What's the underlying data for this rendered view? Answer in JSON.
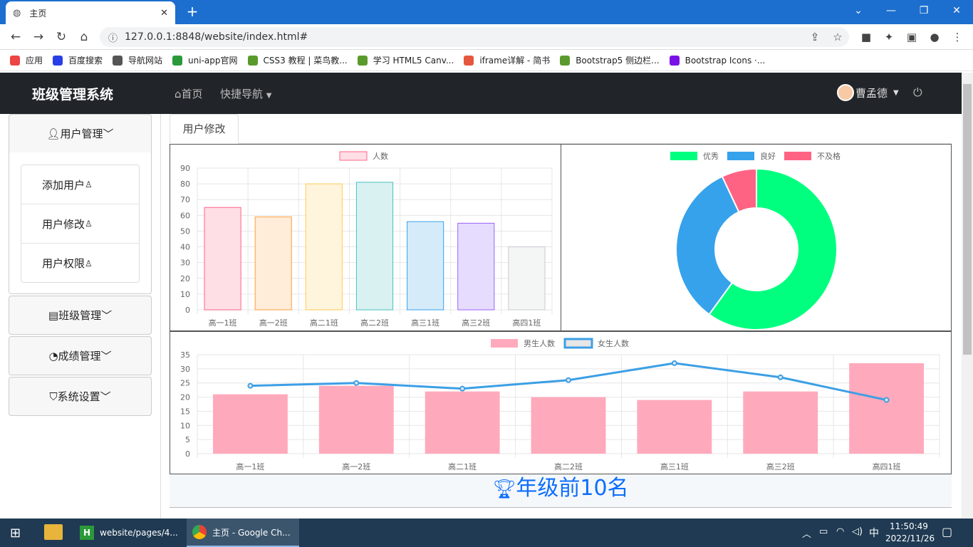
{
  "browser": {
    "tab_title": "主页",
    "tab_close": "✕",
    "new_tab": "+",
    "url": "127.0.0.1:8848/website/index.html#",
    "bookmarks": [
      {
        "label": "应用",
        "color": "#e44"
      },
      {
        "label": "百度搜索",
        "color": "#2a3ee8"
      },
      {
        "label": "导航网站",
        "color": "#555"
      },
      {
        "label": "uni-app官网",
        "color": "#2b9939"
      },
      {
        "label": "CSS3 教程 | 菜鸟教...",
        "color": "#5a9a2d"
      },
      {
        "label": "学习 HTML5 Canv...",
        "color": "#5a9a2d"
      },
      {
        "label": "iframe详解 - 简书",
        "color": "#e5573c"
      },
      {
        "label": "Bootstrap5 侧边栏...",
        "color": "#5a9a2d"
      },
      {
        "label": "Bootstrap Icons ·...",
        "color": "#7a12e8"
      }
    ]
  },
  "app": {
    "brand": "班级管理系统",
    "nav_home": "首页",
    "nav_quick": "快捷导航",
    "user_name": "曹孟德"
  },
  "sidebar": {
    "user_mgmt": "用户管理",
    "items": [
      "添加用户",
      "用户修改",
      "用户权限"
    ],
    "class_mgmt": "班级管理",
    "score_mgmt": "成绩管理",
    "settings": "系统设置"
  },
  "page_tab": "用户修改",
  "top10_title": "年级前10名",
  "chart_data": [
    {
      "type": "bar",
      "categories": [
        "高一1班",
        "高一2班",
        "高二1班",
        "高二2班",
        "高三1班",
        "高三2班",
        "高四1班"
      ],
      "series": [
        {
          "name": "人数",
          "values": [
            65,
            59,
            80,
            81,
            56,
            55,
            40
          ]
        }
      ],
      "ylim": [
        0,
        90
      ],
      "yticks": [
        0,
        10,
        20,
        30,
        40,
        50,
        60,
        70,
        80,
        90
      ],
      "colors_fill": [
        "#ffdfe6",
        "#ffecd9",
        "#fff4dc",
        "#d9f1f1",
        "#d6ebfa",
        "#e6dcfd",
        "#f4f5f5"
      ],
      "colors_stroke": [
        "#ff6384",
        "#ff9f40",
        "#ffcd56",
        "#4bc0c0",
        "#36a2eb",
        "#9966ff",
        "#c9cbcf"
      ]
    },
    {
      "type": "pie",
      "labels": [
        "优秀",
        "良好",
        "不及格"
      ],
      "values": [
        60,
        33,
        7
      ],
      "colors": [
        "#00ff7f",
        "#36a2eb",
        "#ff6384"
      ]
    },
    {
      "type": "bar",
      "categories": [
        "高一1班",
        "高一2班",
        "高二1班",
        "高二2班",
        "高三1班",
        "高三2班",
        "高四1班"
      ],
      "series": [
        {
          "name": "男生人数",
          "type": "bar",
          "values": [
            21,
            24,
            22,
            20,
            19,
            22,
            32
          ],
          "color": "#ffaabc"
        },
        {
          "name": "女生人数",
          "type": "line",
          "values": [
            24,
            25,
            23,
            26,
            32,
            27,
            19
          ],
          "color": "#3c9fe5"
        }
      ],
      "ylim": [
        0,
        35
      ],
      "yticks": [
        0,
        5,
        10,
        15,
        20,
        25,
        30,
        35
      ]
    }
  ],
  "taskbar": {
    "apps": [
      "website/pages/4...",
      "主页 - Google Ch..."
    ],
    "ime": "中",
    "time": "11:50:49",
    "date": "2022/11/26"
  }
}
